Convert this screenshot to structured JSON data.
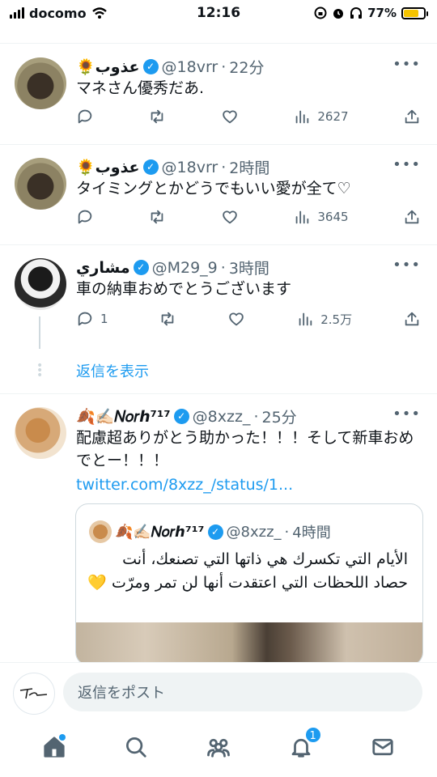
{
  "status_bar": {
    "carrier": "docomo",
    "time": "12:16",
    "battery": "77%"
  },
  "tweets": [
    {
      "name": "🌻عذوب",
      "handle": "@18vrr",
      "time": "22分",
      "text": "マネさん優秀だあ.",
      "replies": "",
      "views": "2627"
    },
    {
      "name": "🌻عذوب",
      "handle": "@18vrr",
      "time": "2時間",
      "text": "タイミングとかどうでもいい愛が全て♡",
      "replies": "",
      "views": "3645"
    },
    {
      "name": "مشاري",
      "handle": "@M29_9",
      "time": "3時間",
      "text": "車の納車おめでとうございます",
      "replies": "1",
      "views": "2.5万",
      "show_replies": "返信を表示"
    },
    {
      "name": "🍂✍🏻𝑁𝑜𝑟ℎ⁷¹⁷",
      "handle": "@8xzz_",
      "time": "25分",
      "text": "配慮超ありがとう助かった！！！そして新車おめでとー！！！",
      "link": "twitter.com/8xzz_/status/1...",
      "quote": {
        "name": "🍂✍🏻𝑁𝑜𝑟ℎ⁷¹⁷",
        "handle": "@8xzz_",
        "time": "4時間",
        "text": "الأيام التي تكسرك هي ذاتها التي تصنعك، أنت حصاد اللحظات التي اعتقدت أنها لن تمر ومرّت 💛"
      }
    }
  ],
  "reply_bar": {
    "placeholder": "返信をポスト"
  },
  "bottom_nav": {
    "notifications_badge": "1"
  },
  "colors": {
    "accent": "#1d9bf0",
    "muted": "#536471"
  }
}
